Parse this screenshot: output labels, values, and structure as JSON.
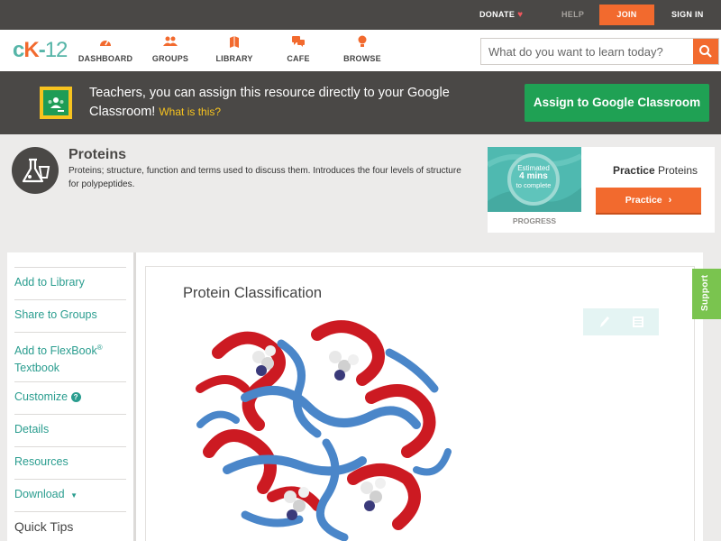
{
  "topbar": {
    "donate": "DONATE",
    "help": "HELP",
    "join": "JOIN",
    "signin": "SIGN IN"
  },
  "nav": {
    "items": [
      {
        "label": "DASHBOARD",
        "icon": "dashboard-icon"
      },
      {
        "label": "GROUPS",
        "icon": "groups-icon"
      },
      {
        "label": "LIBRARY",
        "icon": "library-icon"
      },
      {
        "label": "CAFE",
        "icon": "cafe-icon"
      },
      {
        "label": "BROWSE",
        "icon": "browse-icon"
      }
    ],
    "search_placeholder": "What do you want to learn today?"
  },
  "classroom_banner": {
    "text": "Teachers, you can assign this resource directly to your Google Classroom!",
    "what_link": "What is this?",
    "assign_button": "Assign to Google Classroom"
  },
  "concept": {
    "title": "Proteins",
    "description": "Proteins; structure, function and terms used to discuss them. Introduces the four levels of structure for polypeptides."
  },
  "practice_card": {
    "estimated": "Estimated",
    "duration": "4 mins",
    "to_complete": "to complete",
    "progress_label": "PROGRESS",
    "title_bold": "Practice",
    "title_rest": "Proteins",
    "button": "Practice"
  },
  "sidebar": {
    "add_library": "Add to Library",
    "share_groups": "Share to Groups",
    "add_flexbook_1": "Add to FlexBook",
    "add_flexbook_2": "Textbook",
    "customize": "Customize",
    "details": "Details",
    "resources": "Resources",
    "download": "Download",
    "quick_tips": "Quick Tips"
  },
  "main": {
    "title": "Protein Classification",
    "image_alt": "protein ribbon model"
  },
  "support": "Support",
  "colors": {
    "orange": "#f26a2e",
    "teal": "#2a9d8f",
    "dark": "#4a4846",
    "google_green": "#1fa154",
    "support_green": "#7ac44f"
  }
}
